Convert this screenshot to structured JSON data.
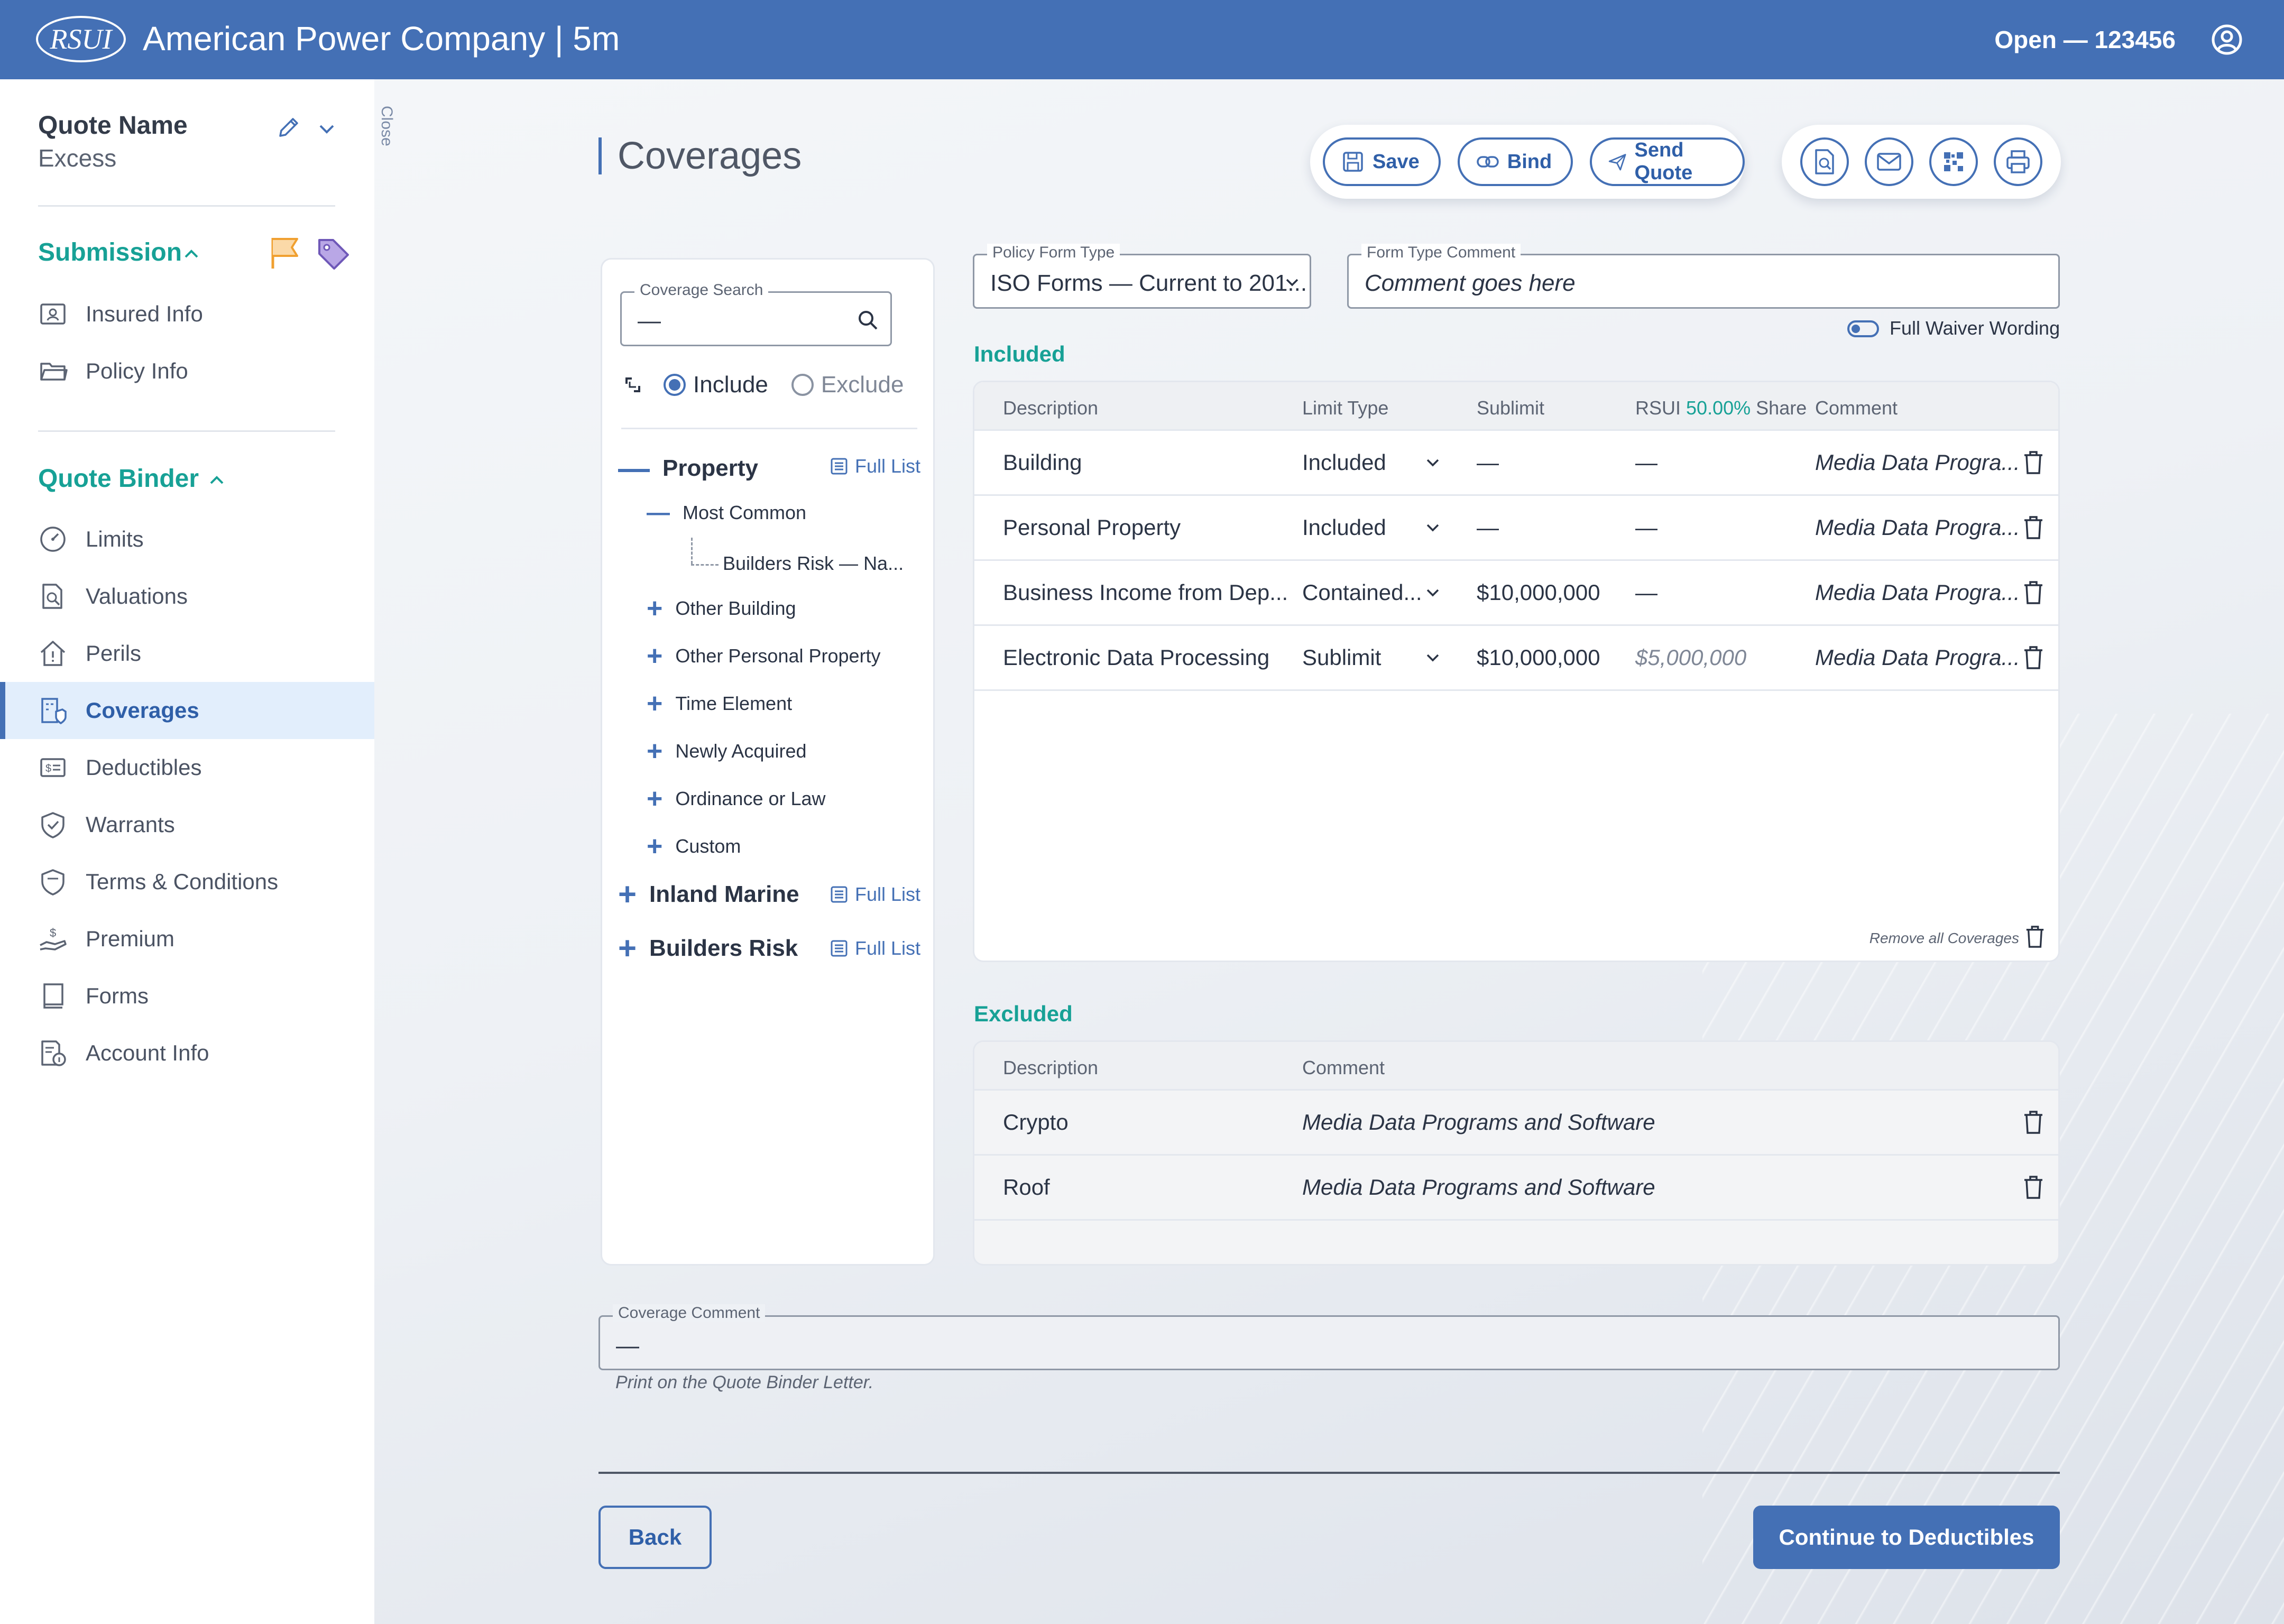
{
  "header": {
    "logo_text": "RSUI",
    "title": "American Power Company | 5m",
    "status": "Open — 123456"
  },
  "sidebar": {
    "quote_name_label": "Quote Name",
    "quote_type": "Excess",
    "close_label": "Close",
    "submission": {
      "label": "Submission",
      "items": [
        {
          "label": "Insured Info",
          "icon": "id-card-icon"
        },
        {
          "label": "Policy Info",
          "icon": "folder-icon"
        }
      ]
    },
    "quote_binder": {
      "label": "Quote Binder",
      "items": [
        {
          "label": "Limits",
          "icon": "gauge-icon"
        },
        {
          "label": "Valuations",
          "icon": "doc-search-icon"
        },
        {
          "label": "Perils",
          "icon": "house-alert-icon"
        },
        {
          "label": "Coverages",
          "icon": "building-shield-icon"
        },
        {
          "label": "Deductibles",
          "icon": "dollar-card-icon"
        },
        {
          "label": "Warrants",
          "icon": "shield-check-icon"
        },
        {
          "label": "Terms & Conditions",
          "icon": "shield-list-icon"
        },
        {
          "label": "Premium",
          "icon": "hand-dollar-icon"
        },
        {
          "label": "Forms",
          "icon": "book-icon"
        },
        {
          "label": "Account Info",
          "icon": "doc-info-icon"
        }
      ],
      "active": "Coverages"
    }
  },
  "page": {
    "title": "Coverages",
    "actions": {
      "save": "Save",
      "bind": "Bind",
      "send_quote": "Send Quote"
    }
  },
  "tree": {
    "search_label": "Coverage Search",
    "search_value": "—",
    "include_label": "Include",
    "exclude_label": "Exclude",
    "full_list_label": "Full List",
    "property": "Property",
    "most_common": "Most Common",
    "builders_risk_na": "Builders Risk — Na...",
    "children": [
      "Other Building",
      "Other Personal Property",
      "Time Element",
      "Newly Acquired",
      "Ordinance or Law",
      "Custom"
    ],
    "inland_marine": "Inland Marine",
    "builders_risk": "Builders Risk"
  },
  "form": {
    "policy_form_label": "Policy Form Type",
    "policy_form_value": "ISO Forms — Current to 201...",
    "comment_label": "Form Type Comment",
    "comment_value": "Comment goes here",
    "full_waiver": "Full Waiver Wording"
  },
  "included": {
    "heading": "Included",
    "headers": {
      "description": "Description",
      "limit_type": "Limit Type",
      "sublimit": "Sublimit",
      "share_prefix": "RSUI",
      "share_pct": "50.00%",
      "share_suffix": "Share",
      "comment": "Comment"
    },
    "rows": [
      {
        "description": "Building",
        "limit_type": "Included",
        "sublimit": "—",
        "share": "—",
        "comment": "Media Data Progra..."
      },
      {
        "description": "Personal Property",
        "limit_type": "Included",
        "sublimit": "—",
        "share": "—",
        "comment": "Media Data Progra..."
      },
      {
        "description": "Business Income from Dep...",
        "limit_type": "Contained...",
        "sublimit": "$10,000,000",
        "share": "—",
        "comment": "Media Data Progra..."
      },
      {
        "description": "Electronic Data Processing",
        "limit_type": "Sublimit",
        "sublimit": "$10,000,000",
        "share": "$5,000,000",
        "comment": "Media Data Progra..."
      }
    ],
    "remove_all": "Remove all Coverages"
  },
  "excluded": {
    "heading": "Excluded",
    "headers": {
      "description": "Description",
      "comment": "Comment"
    },
    "rows": [
      {
        "description": "Crypto",
        "comment": "Media Data Programs and Software"
      },
      {
        "description": "Roof",
        "comment": "Media Data Programs and Software"
      }
    ]
  },
  "coverage_comment": {
    "label": "Coverage Comment",
    "value": "—",
    "hint": "Print on the Quote Binder Letter."
  },
  "footer": {
    "back": "Back",
    "next": "Continue to Deductibles"
  },
  "colors": {
    "brand": "#4470b5",
    "accent_green": "#17a196",
    "flag": "#f0a030",
    "tag": "#6f58b8"
  }
}
